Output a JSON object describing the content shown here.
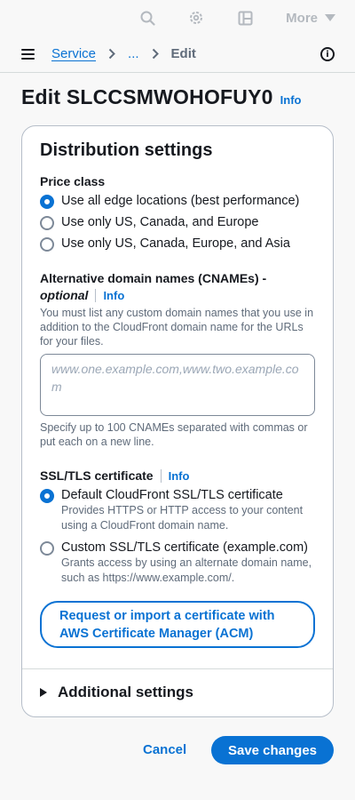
{
  "topbar": {
    "icons": [
      "search-icon",
      "gear-icon",
      "layout-icon"
    ],
    "more_label": "More"
  },
  "breadcrumb": {
    "items": [
      "Service",
      "...",
      "Edit"
    ]
  },
  "page": {
    "title": "Edit SLCCSMWOHOFUY0",
    "info": "Info"
  },
  "distribution": {
    "title": "Distribution settings",
    "price_class": {
      "label": "Price class",
      "options": [
        "Use all edge locations (best performance)",
        "Use only US, Canada, and Europe",
        "Use only US, Canada, Europe, and Asia"
      ],
      "selected_index": 0
    },
    "cnames": {
      "label": "Alternative domain names (CNAMEs) -",
      "optional": "optional",
      "info": "Info",
      "description": "You must list any custom domain names that you use in addition to the CloudFront domain name for the URLs for your files.",
      "placeholder": "www.one.example.com,www.two.example.com",
      "hint": "Specify up to 100 CNAMEs separated with commas or put each on a new line."
    },
    "ssl": {
      "label": "SSL/TLS certificate",
      "info": "Info",
      "options": [
        {
          "label": "Default CloudFront SSL/TLS certificate",
          "description": "Provides HTTPS or HTTP access to your content using a CloudFront domain name."
        },
        {
          "label": "Custom SSL/TLS certificate (example.com)",
          "description": "Grants access by using an alternate domain name, such as https://www.example.com/."
        }
      ],
      "selected_index": 0,
      "acm_button": "Request or import a certificate with AWS Certificate Manager (ACM)"
    },
    "additional_settings": "Additional settings"
  },
  "footer": {
    "cancel": "Cancel",
    "save": "Save changes"
  },
  "colors": {
    "accent": "#0972d3",
    "text": "#16191f",
    "muted": "#5f6b7a"
  }
}
